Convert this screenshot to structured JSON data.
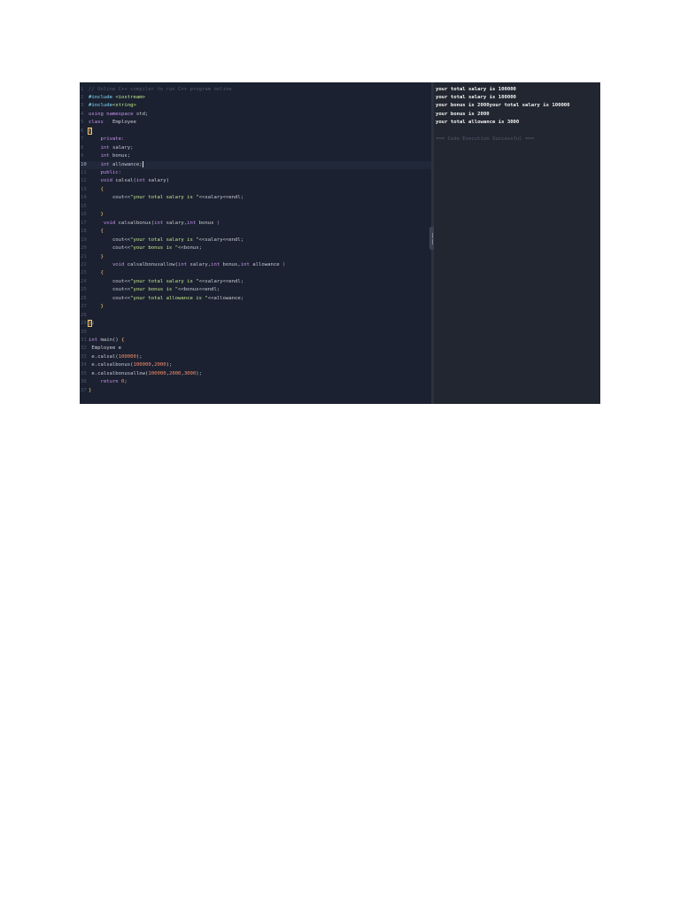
{
  "editor": {
    "lines": [
      {
        "n": "1",
        "segs": [
          {
            "t": "// Online C++ compiler to run C++ program online",
            "c": "cm"
          }
        ]
      },
      {
        "n": "2",
        "segs": [
          {
            "t": "#include ",
            "c": "pp"
          },
          {
            "t": "<iostream>",
            "c": "str"
          }
        ]
      },
      {
        "n": "3",
        "segs": [
          {
            "t": "#include",
            "c": "pp"
          },
          {
            "t": "<string>",
            "c": "str"
          }
        ]
      },
      {
        "n": "4",
        "segs": [
          {
            "t": "using namespace",
            "c": "kw"
          },
          {
            "t": " std;",
            "c": ""
          }
        ]
      },
      {
        "n": "5",
        "segs": [
          {
            "t": "class",
            "c": "kw"
          },
          {
            "t": "   Employee",
            "c": ""
          }
        ]
      },
      {
        "n": "6",
        "segs": [
          {
            "t": "{",
            "c": "brhl"
          }
        ]
      },
      {
        "n": "7",
        "segs": [
          {
            "t": "    private:",
            "c": "kw"
          }
        ]
      },
      {
        "n": "8",
        "segs": [
          {
            "t": "    int",
            "c": "kw"
          },
          {
            "t": " salary;",
            "c": ""
          }
        ]
      },
      {
        "n": "9",
        "segs": [
          {
            "t": "    int",
            "c": "kw"
          },
          {
            "t": " bonus;",
            "c": ""
          }
        ]
      },
      {
        "n": "10",
        "hl": true,
        "cursor": true,
        "segs": [
          {
            "t": "    int",
            "c": "kw"
          },
          {
            "t": " allowance;",
            "c": ""
          }
        ]
      },
      {
        "n": "11",
        "segs": [
          {
            "t": "    public:",
            "c": "kw"
          }
        ]
      },
      {
        "n": "12",
        "segs": [
          {
            "t": "    void",
            "c": "kw"
          },
          {
            "t": " calsal(",
            "c": ""
          },
          {
            "t": "int",
            "c": "kw"
          },
          {
            "t": " salary)",
            "c": ""
          }
        ]
      },
      {
        "n": "13",
        "segs": [
          {
            "t": "    {",
            "c": "br"
          }
        ]
      },
      {
        "n": "14",
        "segs": [
          {
            "t": "        cout<<",
            "c": ""
          },
          {
            "t": "\"your total salary is \"",
            "c": "str"
          },
          {
            "t": "<<salary<<endl;",
            "c": ""
          }
        ]
      },
      {
        "n": "15",
        "segs": [
          {
            "t": "",
            "c": ""
          }
        ]
      },
      {
        "n": "16",
        "segs": [
          {
            "t": "    }",
            "c": "br"
          }
        ]
      },
      {
        "n": "17",
        "segs": [
          {
            "t": "     void",
            "c": "kw"
          },
          {
            "t": " calsalbonus(",
            "c": ""
          },
          {
            "t": "int",
            "c": "kw"
          },
          {
            "t": " salary,",
            "c": ""
          },
          {
            "t": "int",
            "c": "kw"
          },
          {
            "t": " bonus ",
            "c": ""
          },
          {
            "t": ")",
            "c": "kw"
          }
        ]
      },
      {
        "n": "18",
        "segs": [
          {
            "t": "    {",
            "c": "br"
          }
        ]
      },
      {
        "n": "19",
        "segs": [
          {
            "t": "        cout<<",
            "c": ""
          },
          {
            "t": "\"your total salary is \"",
            "c": "str"
          },
          {
            "t": "<<salary<<endl;",
            "c": ""
          }
        ]
      },
      {
        "n": "20",
        "segs": [
          {
            "t": "        cout<<",
            "c": ""
          },
          {
            "t": "\"your bonus is \"",
            "c": "str"
          },
          {
            "t": "<<bonus;",
            "c": ""
          }
        ]
      },
      {
        "n": "21",
        "segs": [
          {
            "t": "    }",
            "c": "br"
          }
        ]
      },
      {
        "n": "22",
        "segs": [
          {
            "t": "        void",
            "c": "kw"
          },
          {
            "t": " calsalbonusallow(",
            "c": ""
          },
          {
            "t": "int",
            "c": "kw"
          },
          {
            "t": " salary,",
            "c": ""
          },
          {
            "t": "int",
            "c": "kw"
          },
          {
            "t": " bonus,",
            "c": ""
          },
          {
            "t": "int",
            "c": "kw"
          },
          {
            "t": " allowance ",
            "c": ""
          },
          {
            "t": ")",
            "c": "kw"
          }
        ]
      },
      {
        "n": "23",
        "segs": [
          {
            "t": "    {",
            "c": "br"
          }
        ]
      },
      {
        "n": "24",
        "segs": [
          {
            "t": "        cout<<",
            "c": ""
          },
          {
            "t": "\"your total salary is \"",
            "c": "str"
          },
          {
            "t": "<<salary<<endl;",
            "c": ""
          }
        ]
      },
      {
        "n": "25",
        "segs": [
          {
            "t": "        cout<<",
            "c": ""
          },
          {
            "t": "\"your bonus is \"",
            "c": "str"
          },
          {
            "t": "<<bonus<<endl;",
            "c": ""
          }
        ]
      },
      {
        "n": "26",
        "segs": [
          {
            "t": "        cout<<",
            "c": ""
          },
          {
            "t": "\"your total allowance is \"",
            "c": "str"
          },
          {
            "t": "<<allowance;",
            "c": ""
          }
        ]
      },
      {
        "n": "27",
        "segs": [
          {
            "t": "    }",
            "c": "br"
          }
        ]
      },
      {
        "n": "28",
        "segs": [
          {
            "t": "",
            "c": ""
          }
        ]
      },
      {
        "n": "29",
        "segs": [
          {
            "t": "}",
            "c": "brhl"
          },
          {
            "t": ";",
            "c": ""
          }
        ]
      },
      {
        "n": "30",
        "segs": [
          {
            "t": "",
            "c": ""
          }
        ]
      },
      {
        "n": "31",
        "segs": [
          {
            "t": "int",
            "c": "kw"
          },
          {
            "t": " main() ",
            "c": ""
          },
          {
            "t": "{",
            "c": "br"
          }
        ]
      },
      {
        "n": "32",
        "segs": [
          {
            "t": " Employee e",
            "c": ""
          }
        ]
      },
      {
        "n": "33",
        "segs": [
          {
            "t": " e.calsal(",
            "c": ""
          },
          {
            "t": "100000",
            "c": "num"
          },
          {
            "t": ");",
            "c": ""
          }
        ]
      },
      {
        "n": "34",
        "segs": [
          {
            "t": " e.calsalbonus(",
            "c": ""
          },
          {
            "t": "100000",
            "c": "num"
          },
          {
            "t": ",",
            "c": ""
          },
          {
            "t": "2000",
            "c": "num"
          },
          {
            "t": ");",
            "c": ""
          }
        ]
      },
      {
        "n": "35",
        "segs": [
          {
            "t": " e.calsalbonusallow(",
            "c": ""
          },
          {
            "t": "100000",
            "c": "num"
          },
          {
            "t": ",",
            "c": ""
          },
          {
            "t": "2000",
            "c": "num"
          },
          {
            "t": ",",
            "c": ""
          },
          {
            "t": "3000",
            "c": "num"
          },
          {
            "t": ");",
            "c": ""
          }
        ]
      },
      {
        "n": "36",
        "segs": [
          {
            "t": "    return ",
            "c": "kw"
          },
          {
            "t": "0",
            "c": "num"
          },
          {
            "t": ";",
            "c": ""
          }
        ]
      },
      {
        "n": "37",
        "segs": [
          {
            "t": "}",
            "c": "br"
          }
        ]
      }
    ]
  },
  "output": {
    "lines": [
      "your total salary is 100000",
      "your total salary is 100000",
      "your bonus is 2000your total salary is 100000",
      "your bonus is 2000",
      "your total allowance is 3000",
      "",
      "=== Code Execution Successful ==="
    ]
  },
  "colors": {
    "editor_bg": "#1b2130",
    "output_bg": "#222630",
    "keyword": "#c792ea",
    "string": "#c3e88d",
    "number": "#f78c6c",
    "bracket": "#ffcb6b"
  }
}
